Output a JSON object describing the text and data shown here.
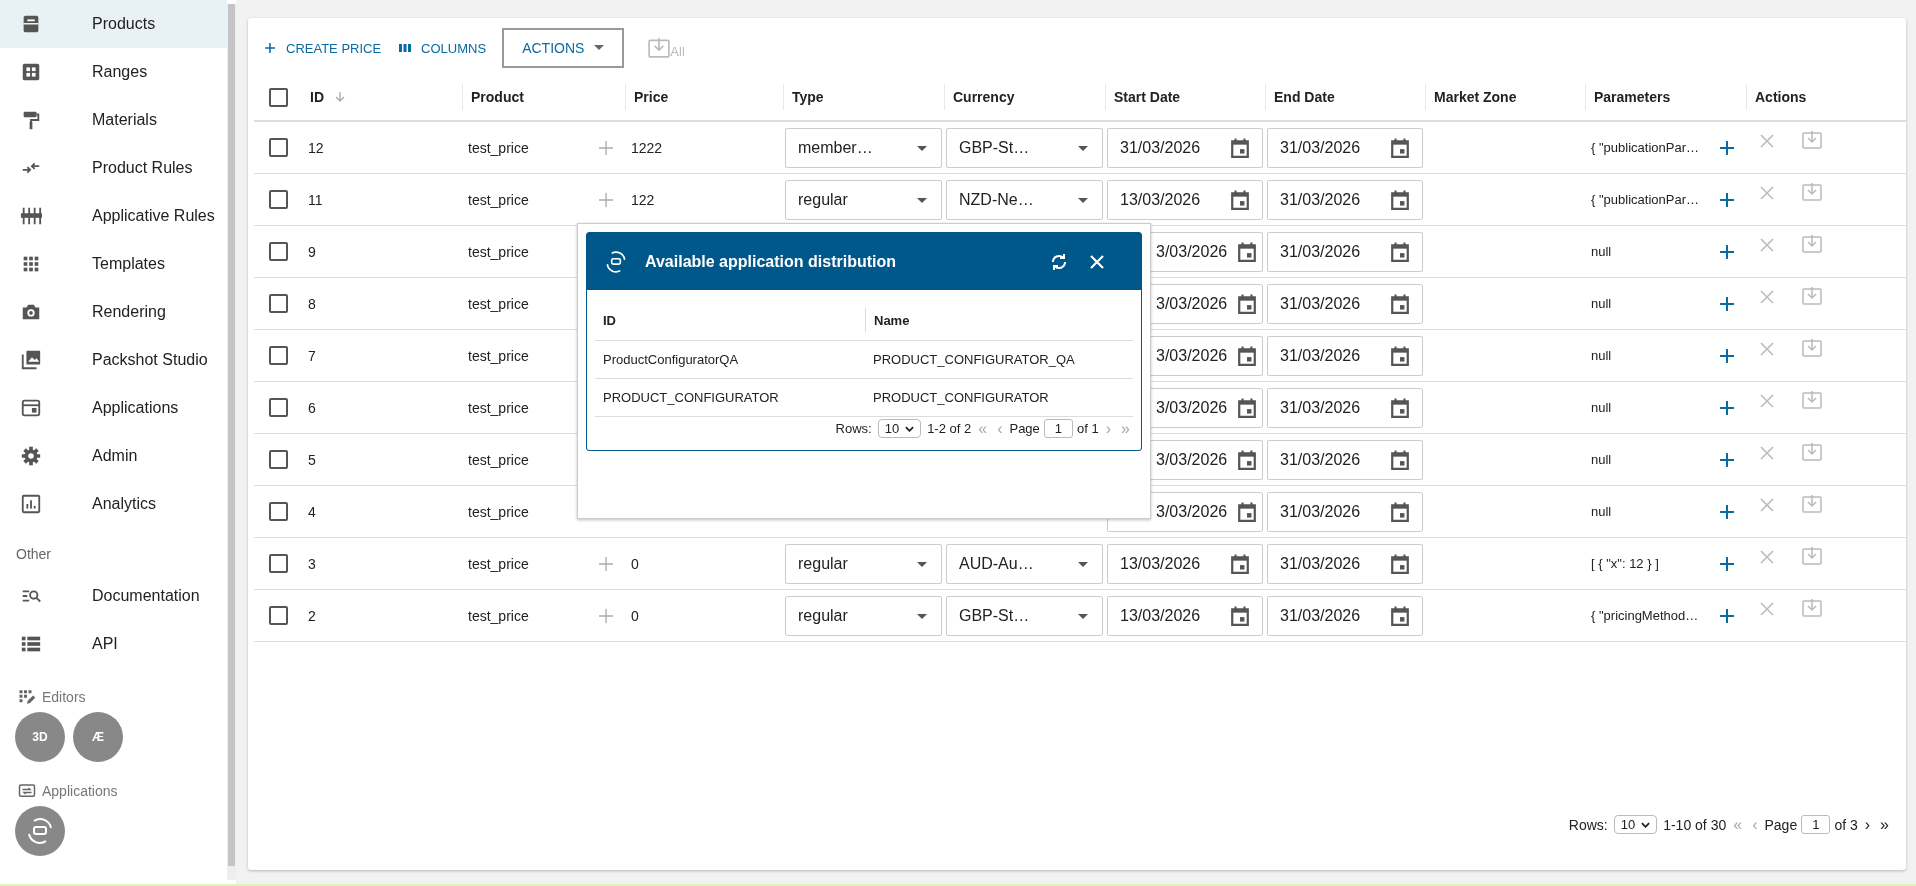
{
  "sidebar": {
    "items": [
      {
        "label": "Products",
        "selected": true
      },
      {
        "label": "Ranges",
        "selected": false
      },
      {
        "label": "Materials",
        "selected": false
      },
      {
        "label": "Product Rules",
        "selected": false
      },
      {
        "label": "Applicative Rules",
        "selected": false
      },
      {
        "label": "Templates",
        "selected": false
      },
      {
        "label": "Rendering",
        "selected": false
      },
      {
        "label": "Packshot Studio",
        "selected": false
      },
      {
        "label": "Applications",
        "selected": false
      },
      {
        "label": "Admin",
        "selected": false
      },
      {
        "label": "Analytics",
        "selected": false
      }
    ],
    "other_heading": "Other",
    "other_items": [
      {
        "label": "Documentation",
        "selected": false
      },
      {
        "label": "API",
        "selected": false
      }
    ],
    "editors_label": "Editors",
    "editors": [
      "3D",
      "Æ"
    ],
    "applications_label": "Applications"
  },
  "toolbar": {
    "create_price": "CREATE PRICE",
    "columns": "COLUMNS",
    "actions": "ACTIONS",
    "download_all": "All"
  },
  "table": {
    "header_checked": false,
    "columns": [
      "ID",
      "Product",
      "Price",
      "Type",
      "Currency",
      "Start Date",
      "End Date",
      "Market Zone",
      "Parameters",
      "Actions"
    ],
    "rows": [
      {
        "id": "12",
        "product": "test_price",
        "price": "1222",
        "type": "member…",
        "currency": "GBP-St…",
        "start_date": "31/03/2026",
        "end_date": "31/03/2026",
        "parameters": "{ \"publicationPar…",
        "checked": false
      },
      {
        "id": "11",
        "product": "test_price",
        "price": "122",
        "type": "regular",
        "currency": "NZD-Ne…",
        "start_date": "13/03/2026",
        "end_date": "31/03/2026",
        "parameters": "{ \"publicationPar…",
        "checked": false
      },
      {
        "id": "9",
        "product": "test_price",
        "start_date": "3/03/2026",
        "end_date": "31/03/2026",
        "parameters": "null",
        "checked": false
      },
      {
        "id": "8",
        "product": "test_price",
        "start_date": "3/03/2026",
        "end_date": "31/03/2026",
        "parameters": "null",
        "checked": false
      },
      {
        "id": "7",
        "product": "test_price",
        "start_date": "3/03/2026",
        "end_date": "31/03/2026",
        "parameters": "null",
        "checked": false
      },
      {
        "id": "6",
        "product": "test_price",
        "start_date": "3/03/2026",
        "end_date": "31/03/2026",
        "parameters": "null",
        "checked": false
      },
      {
        "id": "5",
        "product": "test_price",
        "start_date": "3/03/2026",
        "end_date": "31/03/2026",
        "parameters": "null",
        "checked": false
      },
      {
        "id": "4",
        "product": "test_price",
        "start_date": "3/03/2026",
        "end_date": "31/03/2026",
        "parameters": "null",
        "checked": false
      },
      {
        "id": "3",
        "product": "test_price",
        "price": "0",
        "type": "regular",
        "currency": "AUD-Au…",
        "start_date": "13/03/2026",
        "end_date": "31/03/2026",
        "parameters": "[ { \"x\": 12 } ]",
        "checked": false
      },
      {
        "id": "2",
        "product": "test_price",
        "price": "0",
        "type": "regular",
        "currency": "GBP-St…",
        "start_date": "13/03/2026",
        "end_date": "31/03/2026",
        "parameters": "{ \"pricingMethod…",
        "checked": false
      }
    ],
    "pagination": {
      "rows_label": "Rows:",
      "rows_per_page": "10",
      "range": "1-10 of 30",
      "first": "«",
      "prev": "‹",
      "page_label": "Page",
      "page": "1",
      "of": "of 3",
      "next": "›",
      "last": "»",
      "first_disabled": true,
      "prev_disabled": true,
      "next_disabled": false,
      "last_disabled": false
    }
  },
  "dialog": {
    "title": "Available application distribution",
    "columns": [
      "ID",
      "Name"
    ],
    "rows": [
      {
        "id": "ProductConfiguratorQA",
        "name": "PRODUCT_CONFIGURATOR_QA"
      },
      {
        "id": "PRODUCT_CONFIGURATOR",
        "name": "PRODUCT_CONFIGURATOR"
      }
    ],
    "pagination": {
      "rows_label": "Rows:",
      "rows_per_page": "10",
      "range": "1-2 of 2",
      "first": "«",
      "prev": "‹",
      "page_label": "Page",
      "page": "1",
      "of": "of 1",
      "next": "›",
      "last": "»",
      "first_disabled": true,
      "prev_disabled": true,
      "next_disabled": true,
      "last_disabled": true
    }
  }
}
